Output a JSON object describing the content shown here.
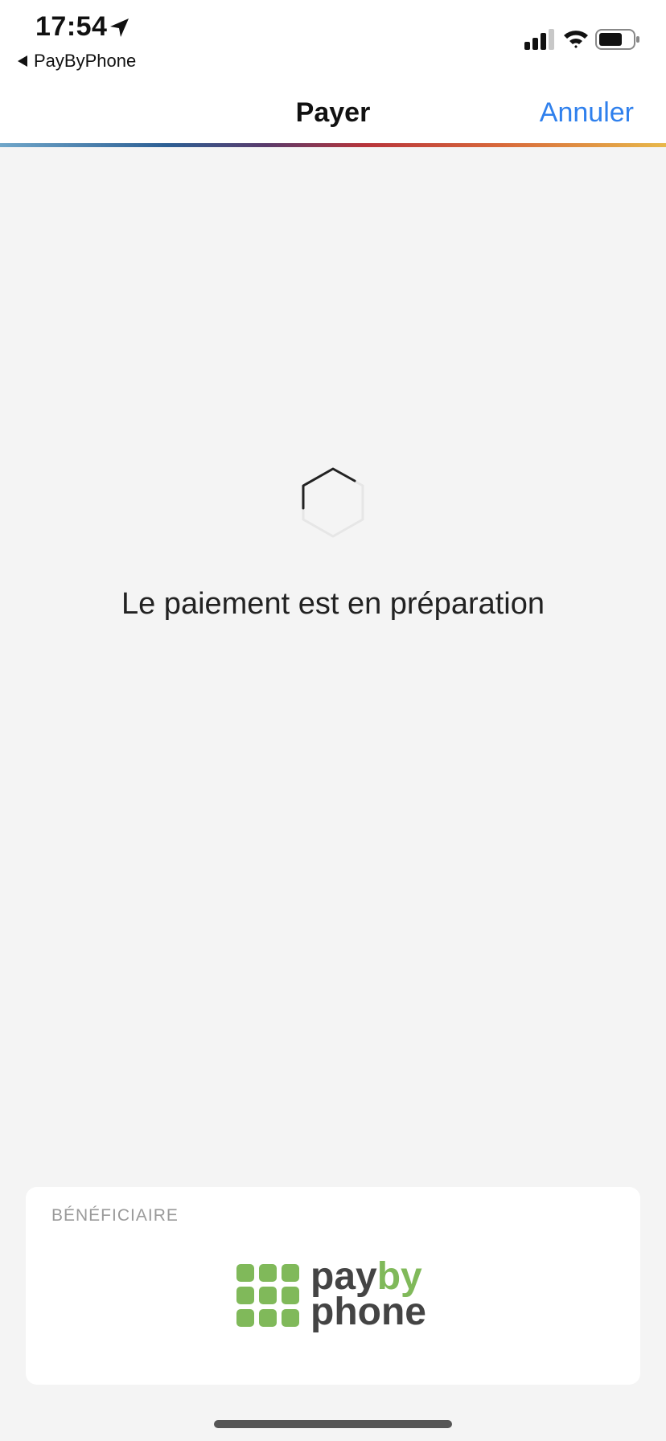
{
  "status_bar": {
    "time": "17:54",
    "back_app_label": "PayByPhone"
  },
  "nav_bar": {
    "title": "Payer",
    "cancel_label": "Annuler"
  },
  "loading": {
    "message": "Le paiement est en préparation"
  },
  "beneficiary": {
    "label": "BÉNÉFICIAIRE",
    "logo_word_pay": "pay",
    "logo_word_by": "by",
    "logo_word_phone": "phone"
  },
  "colors": {
    "accent": "#2f80ed",
    "logo_green": "#80b95a",
    "logo_gray": "#444444",
    "background": "#f4f4f4"
  }
}
